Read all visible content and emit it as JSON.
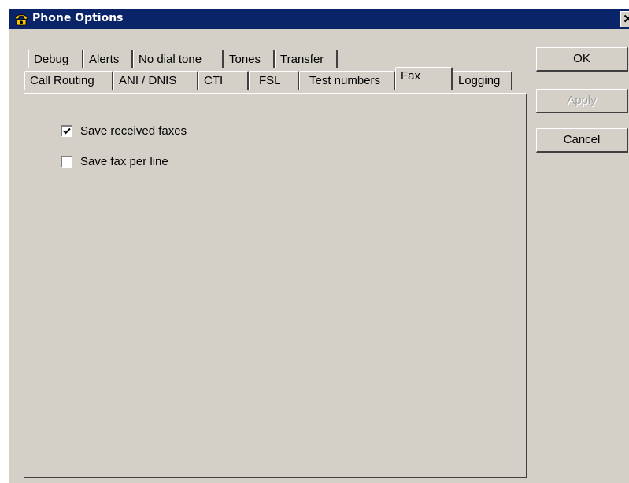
{
  "window": {
    "title": "Phone Options",
    "close_label": "✕"
  },
  "tabs_row1": [
    {
      "label": "Debug"
    },
    {
      "label": "Alerts"
    },
    {
      "label": "No dial tone"
    },
    {
      "label": "Tones"
    },
    {
      "label": "Transfer"
    }
  ],
  "tabs_row2": [
    {
      "label": "Call Routing"
    },
    {
      "label": "ANI / DNIS"
    },
    {
      "label": "CTI"
    },
    {
      "label": "FSL"
    },
    {
      "label": "Test numbers"
    },
    {
      "label": "Fax"
    },
    {
      "label": "Logging"
    }
  ],
  "active_tab": "Fax",
  "fax_panel": {
    "save_received_faxes": {
      "label": "Save received faxes",
      "checked": true
    },
    "save_fax_per_line": {
      "label": "Save fax per line",
      "checked": false
    }
  },
  "buttons": {
    "ok": "OK",
    "apply": "Apply",
    "cancel": "Cancel"
  },
  "colors": {
    "titlebar": "#0a246a",
    "face": "#d4d0c8",
    "icon_yellow": "#f7c600"
  }
}
